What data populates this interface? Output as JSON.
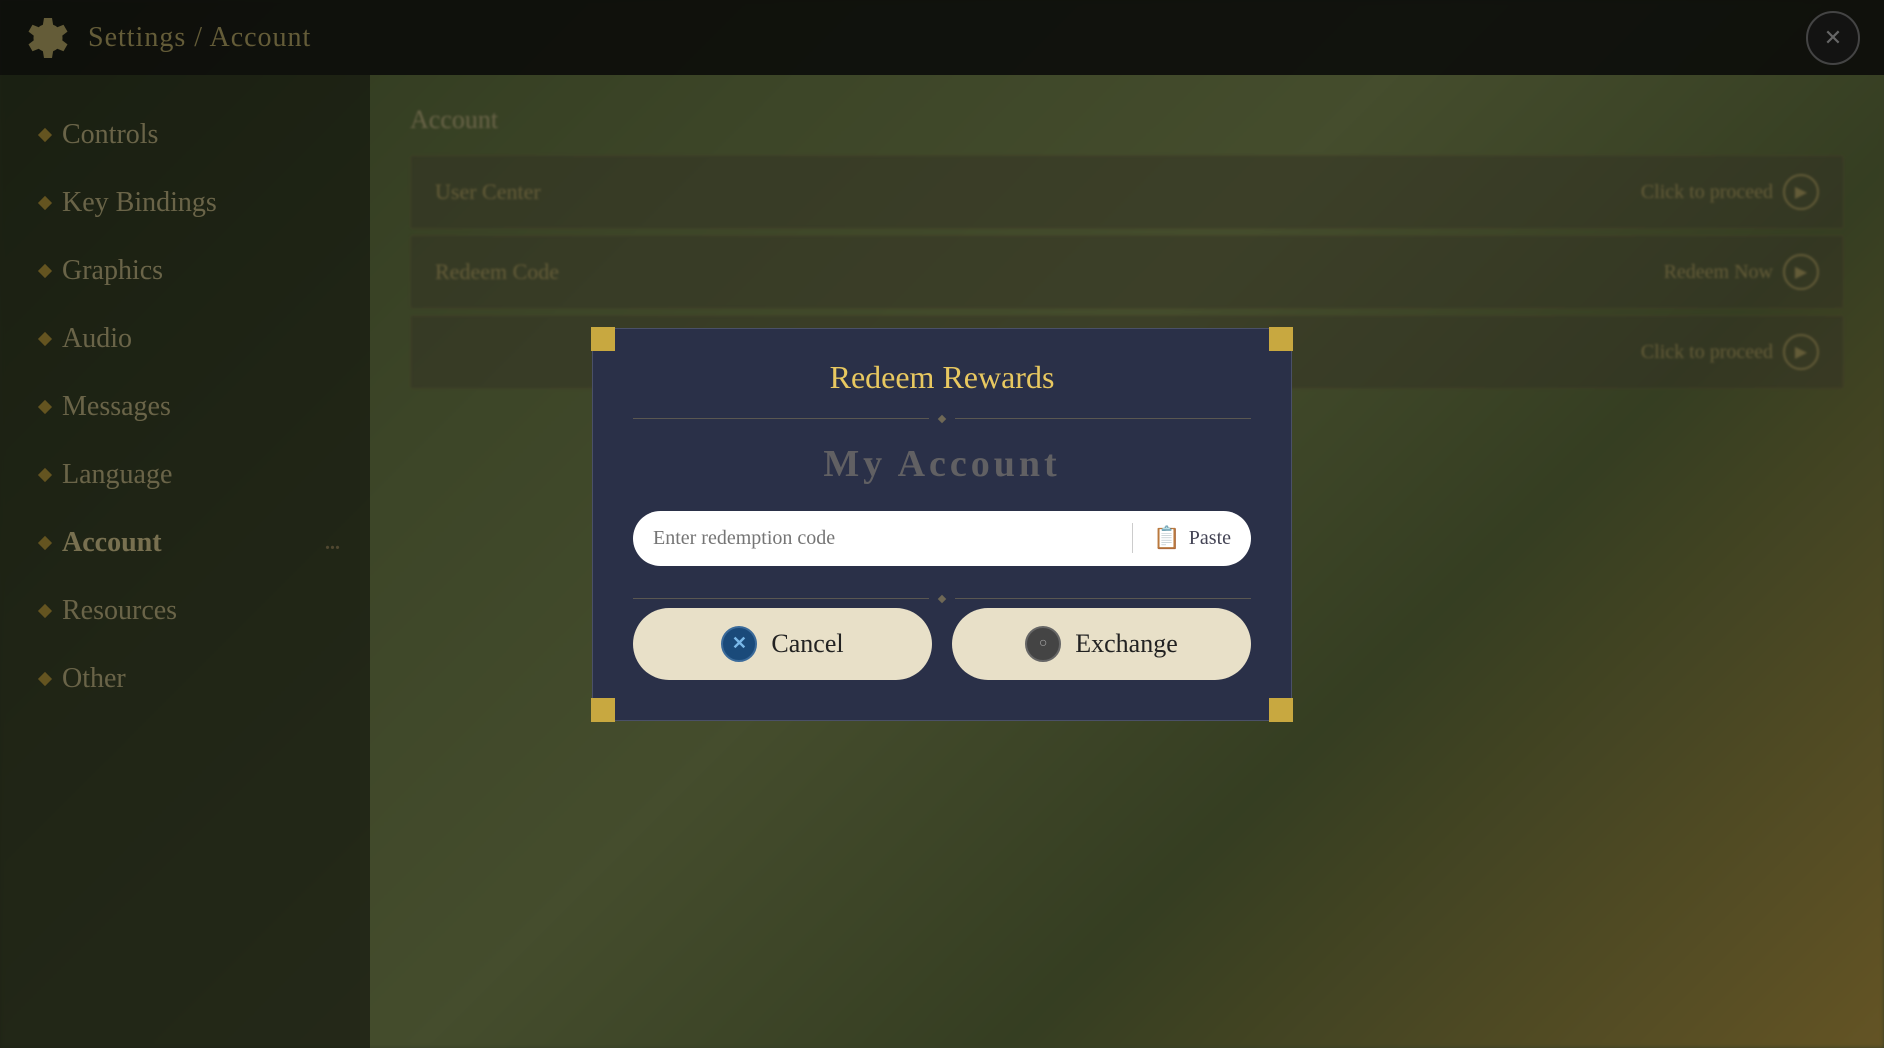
{
  "topbar": {
    "title": "Settings / Account",
    "close_label": "✕"
  },
  "sidebar": {
    "items": [
      {
        "id": "controls",
        "label": "Controls",
        "active": false
      },
      {
        "id": "key-bindings",
        "label": "Key Bindings",
        "active": false
      },
      {
        "id": "graphics",
        "label": "Graphics",
        "active": false
      },
      {
        "id": "audio",
        "label": "Audio",
        "active": false
      },
      {
        "id": "messages",
        "label": "Messages",
        "active": false
      },
      {
        "id": "language",
        "label": "Language",
        "active": false
      },
      {
        "id": "account",
        "label": "Account",
        "active": true
      },
      {
        "id": "resources",
        "label": "Resources",
        "active": false
      },
      {
        "id": "other",
        "label": "Other",
        "active": false
      }
    ]
  },
  "account": {
    "section_title": "Account",
    "rows": [
      {
        "label": "User Center",
        "action": "Click to proceed"
      },
      {
        "label": "Redeem Code",
        "action": "Redeem Now"
      },
      {
        "label": "",
        "action": "Click to proceed"
      }
    ]
  },
  "modal": {
    "title": "Redeem Rewards",
    "subtitle": "My Account",
    "input_placeholder": "Enter redemption code",
    "paste_label": "Paste",
    "cancel_label": "Cancel",
    "exchange_label": "Exchange"
  }
}
